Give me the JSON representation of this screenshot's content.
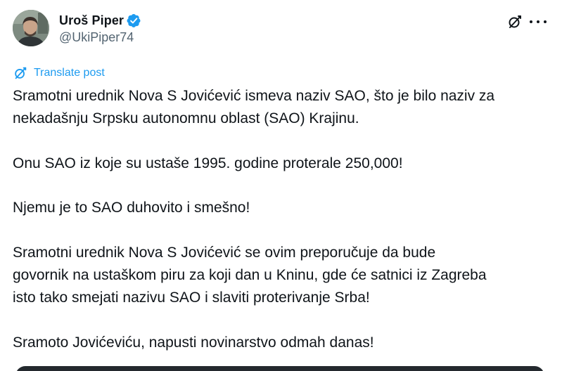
{
  "user": {
    "display_name": "Uroš Piper",
    "handle": "@UkiPiper74",
    "verified": true,
    "avatar_icon": "profile-photo"
  },
  "header_actions": {
    "grok_icon": "grok-slash-icon",
    "more_icon": "more-options-icon"
  },
  "translate": {
    "label": "Translate post",
    "icon": "translate-icon"
  },
  "post": {
    "paragraphs": [
      [
        "Sramotni urednik Nova S Jovićević ismeva naziv SAO,  što je bilo naziv za",
        "nekadašnju Srpsku autonomnu oblast (SAO) Krajinu."
      ],
      [
        "Onu SAO iz koje su ustaše 1995. godine proterale 250,000!"
      ],
      [
        "Njemu je to SAO duhovito i smešno!"
      ],
      [
        "Sramotni urednik Nova S Jovićević se ovim preporučuje da bude",
        "govornik na ustaškom piru za koji dan u Kninu, gde će satnici iz Zagreba",
        "isto tako smejati nazivu SAO i slaviti proterivanje Srba!"
      ],
      [
        "Sramoto Jovićeviću, napusti novinarstvo odmah danas!"
      ]
    ]
  },
  "colors": {
    "text": "#0f1419",
    "secondary": "#536471",
    "accent": "#1d9bf0"
  }
}
